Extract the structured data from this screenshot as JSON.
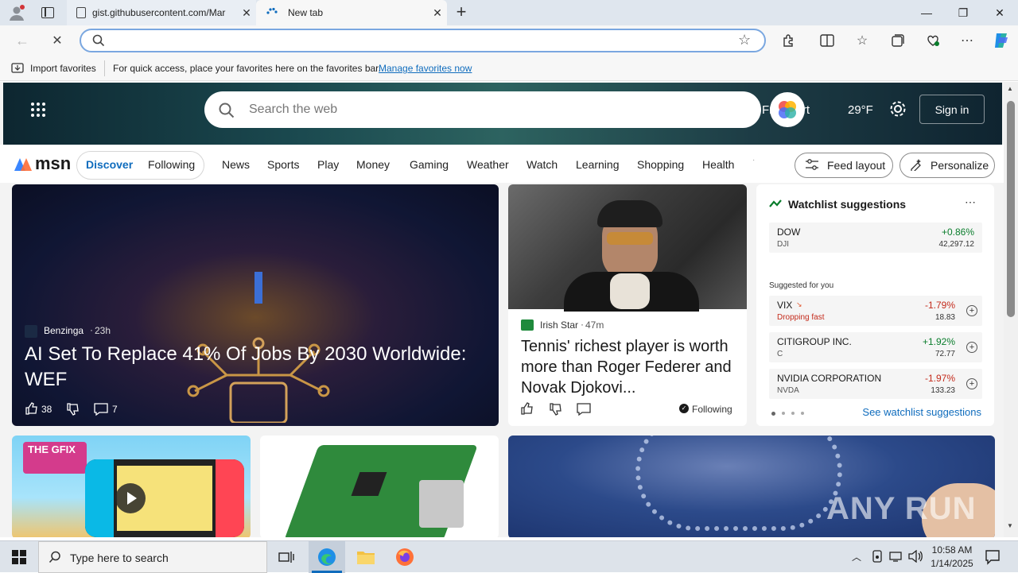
{
  "browser": {
    "tabs": [
      {
        "title": "gist.githubusercontent.com/Mar",
        "active": false
      },
      {
        "title": "New tab",
        "active": true
      }
    ],
    "address_value": "",
    "favorites_bar": {
      "import_label": "Import favorites",
      "hint": "For quick access, place your favorites here on the favorites bar.",
      "manage_link": "Manage favorites now"
    }
  },
  "msn": {
    "search_placeholder": "Search the web",
    "location": "Frankfurt",
    "temperature": "29°F",
    "sign_in": "Sign in",
    "logo_text": "msn",
    "nav": {
      "discover": "Discover",
      "following": "Following",
      "links": [
        "News",
        "Sports",
        "Play",
        "Money",
        "Gaming",
        "Weather",
        "Watch",
        "Learning",
        "Shopping",
        "Health"
      ],
      "feed_layout": "Feed layout",
      "personalize": "Personalize"
    },
    "main_story": {
      "source": "Benzinga",
      "age": "23h",
      "headline": "AI Set To Replace 41% Of Jobs By 2030 Worldwide: WEF",
      "likes": "38",
      "comments": "7"
    },
    "second_story": {
      "source": "Irish Star",
      "age": "47m",
      "headline": "Tennis' richest player is worth more than Roger Federer and Novak Djokovi...",
      "following": "Following"
    },
    "watchlist": {
      "title": "Watchlist suggestions",
      "dow": {
        "name": "DOW",
        "ticker": "DJI",
        "change": "+0.86%",
        "value": "42,297.12"
      },
      "suggested_label": "Suggested for you",
      "stocks": [
        {
          "name": "VIX",
          "sub": "Dropping fast",
          "change": "-1.79%",
          "value": "18.83",
          "up": false
        },
        {
          "name": "CITIGROUP INC.",
          "sub": "C",
          "change": "+1.92%",
          "value": "72.77",
          "up": true
        },
        {
          "name": "NVIDIA CORPORATION",
          "sub": "NVDA",
          "change": "-1.97%",
          "value": "133.23",
          "up": false
        }
      ],
      "see_link": "See watchlist suggestions"
    },
    "gfix_label": "THE GFIX",
    "watermark": "ANY RUN"
  },
  "taskbar": {
    "search_placeholder": "Type here to search",
    "time": "10:58 AM",
    "date": "1/14/2025"
  },
  "colors": {
    "accent": "#0f6cbd",
    "positive": "#0a7d2c",
    "negative": "#c42b1c"
  }
}
